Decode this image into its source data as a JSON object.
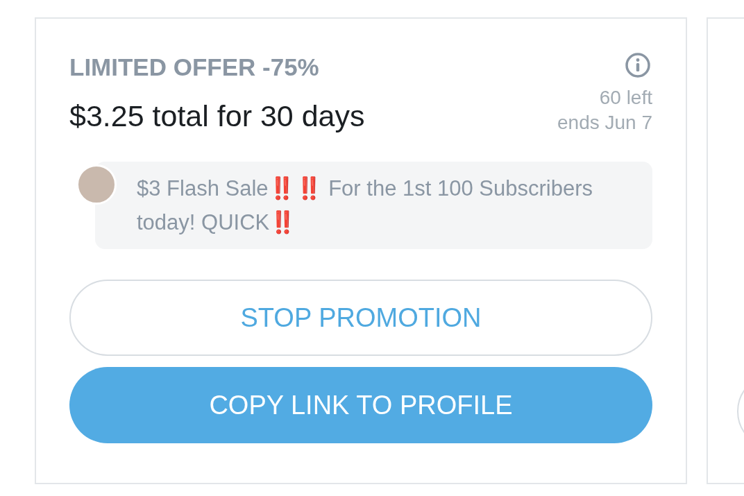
{
  "promotion": {
    "title": "LIMITED OFFER -75%",
    "price": "$3.25 total for 30 days",
    "remaining": "60 left",
    "ends": "ends Jun 7",
    "message": "$3 Flash Sale‼️‼️ For the 1st 100 Subscribers today! QUICK‼️",
    "buttons": [
      {
        "label": "STOP PROMOTION",
        "kind": "outline"
      },
      {
        "label": "COPY LINK TO PROFILE",
        "kind": "filled"
      }
    ]
  }
}
